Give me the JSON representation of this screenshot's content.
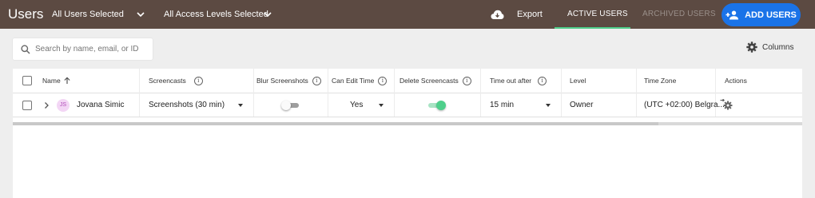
{
  "header": {
    "title": "Users",
    "users_filter": "All Users Selected",
    "access_filter": "All Access Levels Selected",
    "export_label": "Export",
    "tab_active": "ACTIVE USERS",
    "tab_archived": "ARCHIVED USERS",
    "add_users_label": "ADD USERS"
  },
  "toolbar": {
    "search_placeholder": "Search by name, email, or ID",
    "columns_label": "Columns"
  },
  "table": {
    "headers": {
      "name": "Name",
      "screencasts": "Screencasts",
      "blur_screenshots": "Blur Screenshots",
      "can_edit_time": "Can Edit Time",
      "delete_screencasts": "Delete Screencasts",
      "time_out_after": "Time out after",
      "level": "Level",
      "time_zone": "Time Zone",
      "actions": "Actions"
    },
    "rows": [
      {
        "initials": "JS",
        "name": "Jovana Simic",
        "screencasts": "Screenshots (30 min)",
        "blur_screenshots": false,
        "can_edit_time": "Yes",
        "delete_screencasts": true,
        "time_out_after": "15 min",
        "level": "Owner",
        "time_zone": "(UTC +02:00) Belgra..."
      }
    ]
  },
  "colors": {
    "topbar": "#5c4a42",
    "accent_blue": "#1a73e8",
    "accent_green": "#4ecf8b"
  }
}
